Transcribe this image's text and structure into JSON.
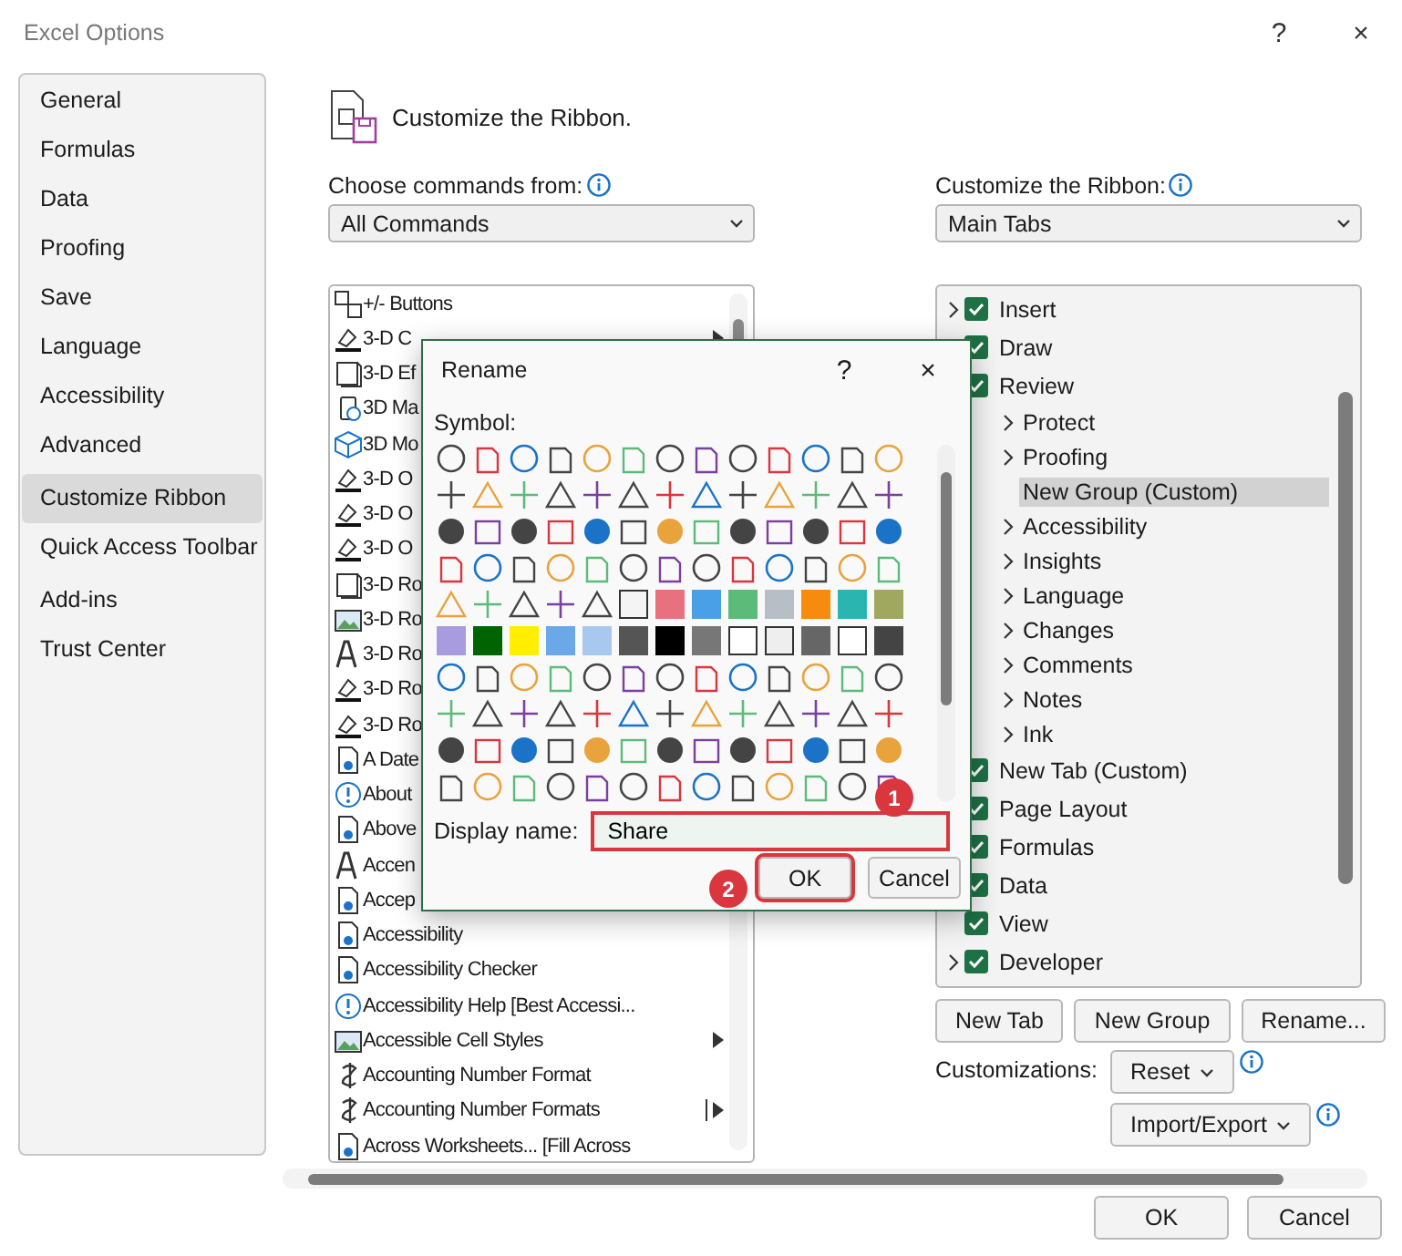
{
  "window": {
    "title": "Excel Options",
    "help": "?",
    "close": "×"
  },
  "sidebar": {
    "groups": [
      [
        {
          "label": "General",
          "selected": false
        },
        {
          "label": "Formulas",
          "selected": false
        },
        {
          "label": "Data",
          "selected": false
        },
        {
          "label": "Proofing",
          "selected": false
        },
        {
          "label": "Save",
          "selected": false
        },
        {
          "label": "Language",
          "selected": false
        },
        {
          "label": "Accessibility",
          "selected": false
        },
        {
          "label": "Advanced",
          "selected": false
        }
      ],
      [
        {
          "label": "Customize Ribbon",
          "selected": true
        },
        {
          "label": "Quick Access Toolbar",
          "selected": false
        }
      ],
      [
        {
          "label": "Add-ins",
          "selected": false
        },
        {
          "label": "Trust Center",
          "selected": false
        }
      ]
    ]
  },
  "heading": "Customize the Ribbon.",
  "commands": {
    "label": "Choose commands from:",
    "dropdown": "All Commands",
    "items": [
      {
        "label": "+/- Buttons",
        "kind": "plain"
      },
      {
        "label": "3-D C",
        "kind": "submenu"
      },
      {
        "label": "3-D Ef",
        "kind": "plain"
      },
      {
        "label": "3D Ma",
        "kind": "plain"
      },
      {
        "label": "3D Mo",
        "kind": "plain"
      },
      {
        "label": "3-D O",
        "kind": "plain"
      },
      {
        "label": "3-D O",
        "kind": "plain"
      },
      {
        "label": "3-D O",
        "kind": "plain"
      },
      {
        "label": "3-D Ro",
        "kind": "plain"
      },
      {
        "label": "3-D Ro",
        "kind": "plain"
      },
      {
        "label": "3-D Ro",
        "kind": "plain"
      },
      {
        "label": "3-D Ro",
        "kind": "plain"
      },
      {
        "label": "3-D Ro",
        "kind": "plain"
      },
      {
        "label": "A Date",
        "kind": "plain"
      },
      {
        "label": "About",
        "kind": "plain"
      },
      {
        "label": "Above",
        "kind": "plain"
      },
      {
        "label": "Accen",
        "kind": "plain"
      },
      {
        "label": "Accep",
        "kind": "plain"
      },
      {
        "label": "Accessibility",
        "kind": "plain"
      },
      {
        "label": "Accessibility Checker",
        "kind": "plain"
      },
      {
        "label": "Accessibility Help [Best Accessi...",
        "kind": "plain"
      },
      {
        "label": "Accessible Cell Styles",
        "kind": "submenu"
      },
      {
        "label": "Accounting Number Format",
        "kind": "plain"
      },
      {
        "label": "Accounting Number Formats",
        "kind": "split"
      },
      {
        "label": "Across Worksheets... [Fill Across",
        "kind": "plain"
      }
    ]
  },
  "ribbon": {
    "label": "Customize the Ribbon:",
    "dropdown": "Main Tabs",
    "tabs": [
      {
        "label": "Insert",
        "checked": true,
        "selected": false,
        "expanded": false
      },
      {
        "label": "Draw",
        "checked": true,
        "selected": false
      },
      {
        "label": "Review",
        "checked": true,
        "selected": false,
        "children": [
          {
            "label": "Protect",
            "selected": false,
            "expanded": false
          },
          {
            "label": "Proofing",
            "selected": false,
            "expanded": false
          },
          {
            "label": "New Group (Custom)",
            "selected": true
          },
          {
            "label": "Accessibility",
            "selected": false,
            "expanded": false
          },
          {
            "label": "Insights",
            "selected": false,
            "expanded": false
          },
          {
            "label": "Language",
            "selected": false,
            "expanded": false
          },
          {
            "label": "Changes",
            "selected": false,
            "expanded": false
          },
          {
            "label": "Comments",
            "selected": false,
            "expanded": false
          },
          {
            "label": "Notes",
            "selected": false,
            "expanded": false
          },
          {
            "label": "Ink",
            "selected": false,
            "expanded": false
          }
        ]
      },
      {
        "label": "New Tab (Custom)",
        "checked": true,
        "selected": false
      },
      {
        "label": "Page Layout",
        "checked": true,
        "selected": false
      },
      {
        "label": "Formulas",
        "checked": true,
        "selected": false
      },
      {
        "label": "Data",
        "checked": true,
        "selected": false
      },
      {
        "label": "View",
        "checked": true,
        "selected": false
      },
      {
        "label": "Developer",
        "checked": true,
        "selected": false,
        "expanded": false
      }
    ],
    "buttons": [
      "New Tab",
      "New Group",
      "Rename..."
    ]
  },
  "customizations": {
    "label": "Customizations:",
    "reset": "Reset",
    "import_export": "Import/Export"
  },
  "footer": {
    "ok": "OK",
    "cancel": "Cancel"
  },
  "rename_dialog": {
    "title": "Rename",
    "help": "?",
    "close": "×",
    "symbol_label": "Symbol:",
    "display_name_label": "Display name:",
    "display_name": "Share",
    "field_highlighted": true,
    "field_badge": "1",
    "ok": "OK",
    "ok_highlighted": true,
    "ok_badge": "2",
    "cancel": "Cancel"
  }
}
